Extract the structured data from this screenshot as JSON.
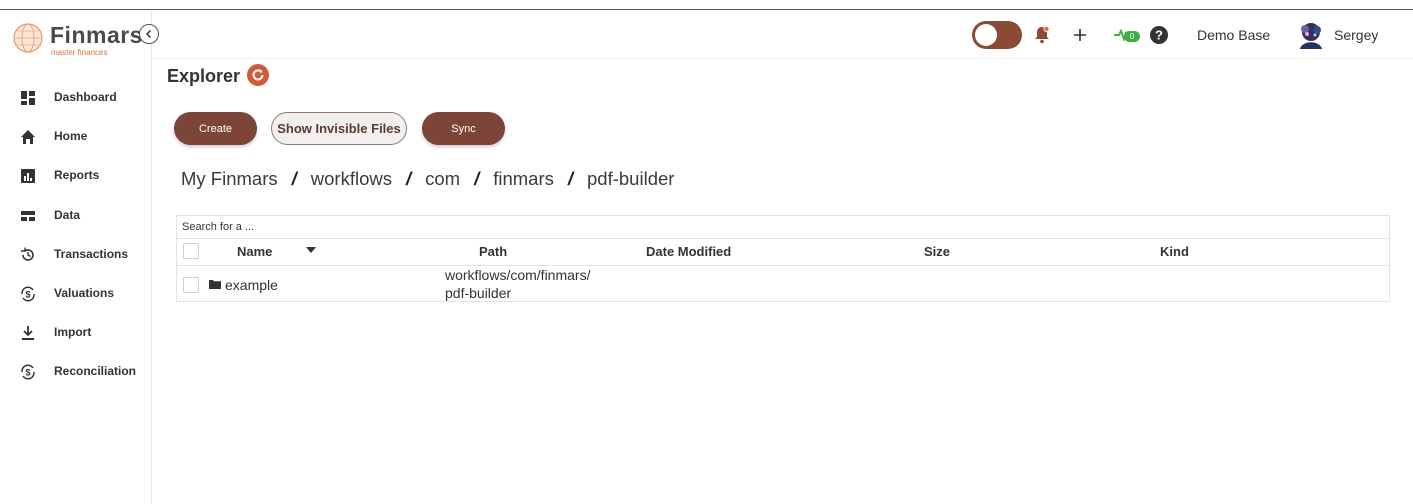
{
  "app": {
    "logo_name": "Finmars",
    "logo_tagline": "master finances"
  },
  "sidebar": {
    "items": [
      {
        "label": "Dashboard",
        "icon": "dashboard-icon"
      },
      {
        "label": "Home",
        "icon": "home-icon"
      },
      {
        "label": "Reports",
        "icon": "reports-icon"
      },
      {
        "label": "Data",
        "icon": "data-icon"
      },
      {
        "label": "Transactions",
        "icon": "history-icon"
      },
      {
        "label": "Valuations",
        "icon": "currency-exchange-icon"
      },
      {
        "label": "Import",
        "icon": "download-icon"
      },
      {
        "label": "Reconciliation",
        "icon": "currency-exchange-icon"
      }
    ]
  },
  "header": {
    "health_badge": "0",
    "base_name": "Demo Base",
    "username": "Sergey"
  },
  "page": {
    "title": "Explorer"
  },
  "toolbar": {
    "create_label": "Create",
    "show_invisible_label": "Show Invisible Files",
    "sync_label": "Sync"
  },
  "breadcrumb": {
    "items": [
      "My Finmars",
      "workflows",
      "com",
      "finmars",
      "pdf-builder"
    ],
    "separator": "/"
  },
  "table": {
    "search_placeholder": "Search for a ...",
    "columns": [
      "Name",
      "Path",
      "Date Modified",
      "Size",
      "Kind"
    ],
    "rows": [
      {
        "name": "example",
        "path_line1": "workflows/com/finmars/",
        "path_line2": "pdf-builder",
        "date_modified": "",
        "size": "",
        "kind": ""
      }
    ]
  },
  "colors": {
    "accent": "#7d4537",
    "refresh": "#d05a3a",
    "health": "#3cb043"
  }
}
